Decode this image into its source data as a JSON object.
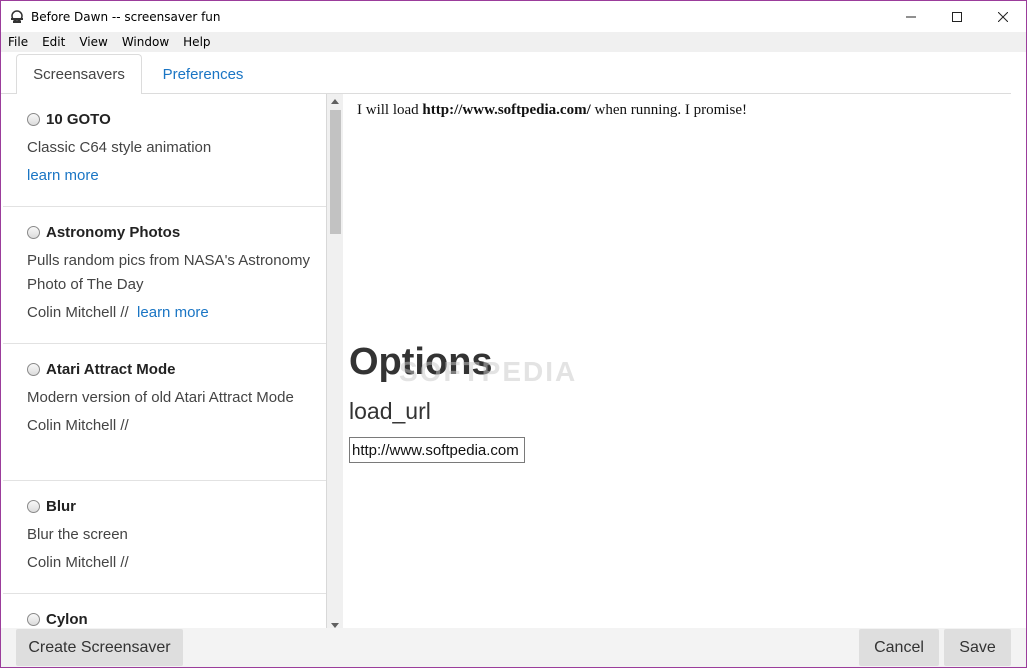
{
  "window": {
    "title": "Before Dawn -- screensaver fun"
  },
  "menu": [
    "File",
    "Edit",
    "View",
    "Window",
    "Help"
  ],
  "tabs": [
    {
      "label": "Screensavers",
      "active": true
    },
    {
      "label": "Preferences",
      "active": false
    }
  ],
  "screensavers": [
    {
      "name": "10 GOTO",
      "desc": "Classic C64 style animation",
      "author": "",
      "link": "learn more"
    },
    {
      "name": "Astronomy Photos",
      "desc": "Pulls random pics from NASA's Astronomy Photo of The Day",
      "author": "Colin Mitchell //",
      "link": "learn more"
    },
    {
      "name": "Atari Attract Mode",
      "desc": "Modern version of old Atari Attract Mode",
      "author": "Colin Mitchell //",
      "link": ""
    },
    {
      "name": "Blur",
      "desc": "Blur the screen",
      "author": "Colin Mitchell //",
      "link": ""
    },
    {
      "name": "Cylon",
      "desc": "",
      "author": "",
      "link": ""
    }
  ],
  "preview": {
    "prefix": "I will load ",
    "url": "http://www.softpedia.com/",
    "suffix": " when running. I promise!"
  },
  "options": {
    "heading": "Options",
    "field_label": "load_url",
    "field_value": "http://www.softpedia.com"
  },
  "watermark": "SOFTPEDIA",
  "buttons": {
    "create": "Create Screensaver",
    "cancel": "Cancel",
    "save": "Save"
  },
  "colors": {
    "link": "#1a75c4",
    "window_border": "#9b3d9b"
  }
}
